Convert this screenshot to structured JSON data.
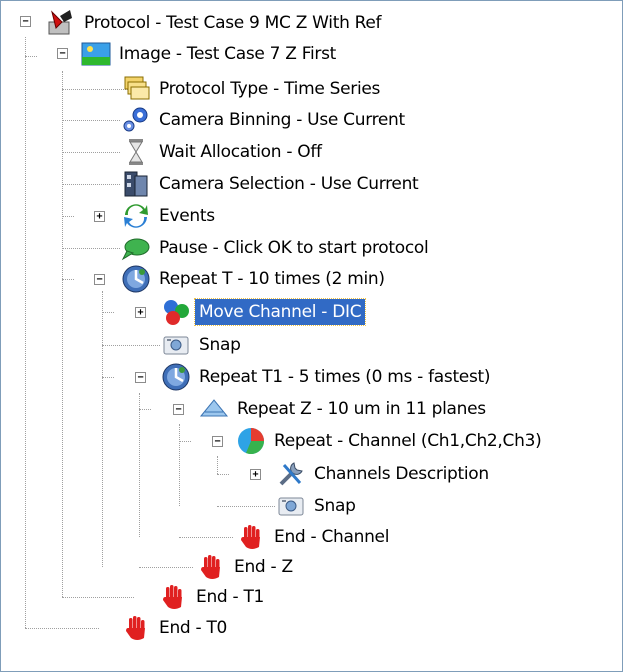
{
  "tree": {
    "items": [
      {
        "label": "Protocol - Test Case 9 MC Z With Ref",
        "icon": "protocol-icon",
        "expander": "minus"
      },
      {
        "label": "Image - Test Case 7 Z First",
        "icon": "image-icon",
        "expander": "minus"
      },
      {
        "label": "Protocol Type - Time Series",
        "icon": "protocol-type-icon"
      },
      {
        "label": "Camera Binning - Use Current",
        "icon": "camera-binning-icon"
      },
      {
        "label": "Wait Allocation - Off",
        "icon": "hourglass-icon"
      },
      {
        "label": "Camera Selection - Use Current",
        "icon": "camera-selection-icon"
      },
      {
        "label": "Events",
        "icon": "events-icon",
        "expander": "plus"
      },
      {
        "label": "Pause - Click OK to start protocol",
        "icon": "pause-icon"
      },
      {
        "label": "Repeat T - 10 times (2 min)",
        "icon": "clock-icon",
        "expander": "minus"
      },
      {
        "label": "Move Channel - DIC",
        "icon": "move-channel-icon",
        "expander": "plus",
        "selected": true
      },
      {
        "label": "Snap",
        "icon": "snap-icon"
      },
      {
        "label": "Repeat T1 - 5 times (0 ms - fastest)",
        "icon": "clock-icon",
        "expander": "minus"
      },
      {
        "label": "Repeat Z - 10 um in 11 planes",
        "icon": "z-stack-icon",
        "expander": "minus"
      },
      {
        "label": "Repeat - Channel (Ch1,Ch2,Ch3)",
        "icon": "channel-icon",
        "expander": "minus"
      },
      {
        "label": "Channels Description",
        "icon": "tools-icon",
        "expander": "plus"
      },
      {
        "label": "Snap",
        "icon": "snap-icon"
      },
      {
        "label": "End - Channel",
        "icon": "stop-hand-icon"
      },
      {
        "label": "End - Z",
        "icon": "stop-hand-icon"
      },
      {
        "label": "End - T1",
        "icon": "stop-hand-icon"
      },
      {
        "label": "End - T0",
        "icon": "stop-hand-icon"
      }
    ]
  },
  "colors": {
    "selection": "#316ac5",
    "selection_text": "#ffffff",
    "tree_lines": "#a0a0a0",
    "border": "#7f9db9"
  }
}
